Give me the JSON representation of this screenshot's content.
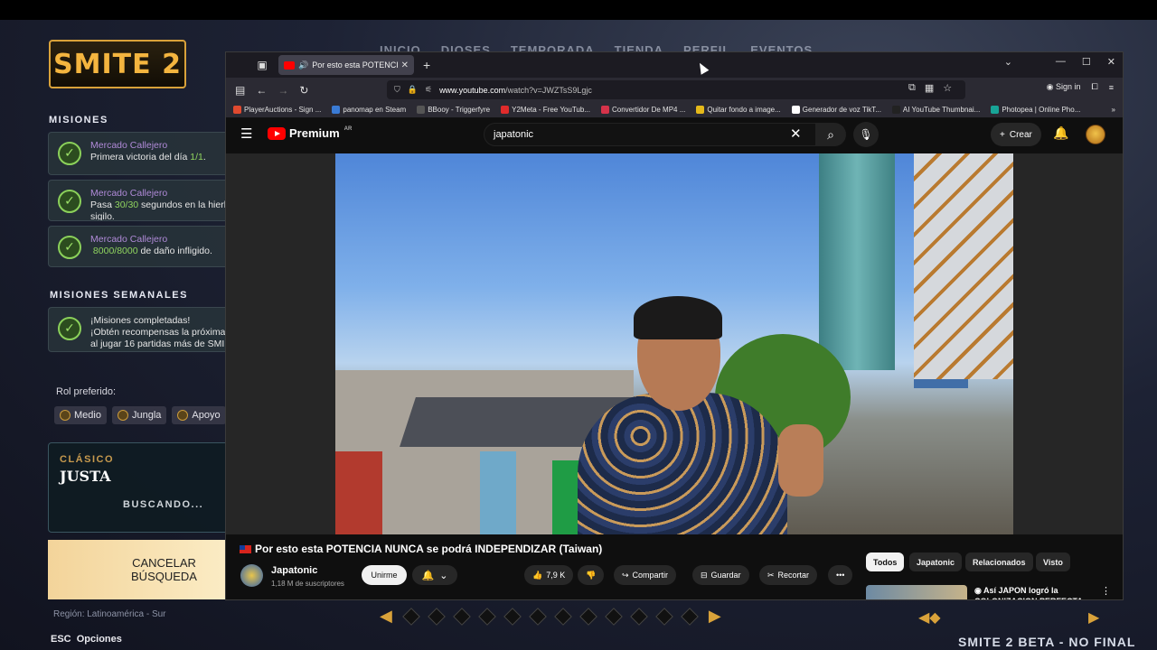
{
  "game": {
    "logo": "SMITE 2",
    "top_nav": [
      "INICIO",
      "DIOSES",
      "TEMPORADA",
      "TIENDA",
      "PERFIL",
      "EVENTOS"
    ],
    "missions_title": "MISIONES",
    "missions": [
      {
        "title": "Mercado Callejero",
        "line1": "Primera victoria del día",
        "progress": "1/1",
        "line2": ""
      },
      {
        "title": "Mercado Callejero",
        "line1_pre": "Pasa ",
        "progress": "30/30",
        "line1_post": " segundos en la hierb",
        "line2": "sigilo."
      },
      {
        "title": "Mercado Callejero",
        "progress": "8000/8000",
        "line1_post": " de daño infligido."
      }
    ],
    "weekly_title": "MISIONES SEMANALES",
    "weekly": {
      "line1": "¡Misiones completadas!",
      "line2": "¡Obtén recompensas la próxima",
      "line3": "al jugar 16 partidas más de SMI"
    },
    "role_label": "Rol preferido:",
    "roles": [
      "Medio",
      "Jungla",
      "Apoyo"
    ],
    "queue": {
      "mode": "CLÁSICO",
      "name": "JUSTA",
      "status": "BUSCANDO..."
    },
    "cancel_label": "CANCELAR BÚSQUEDA",
    "region": "Región: Latinoamérica - Sur",
    "esc_label": "ESC",
    "options_label": "Opciones",
    "bottom_right": "SMITE 2 BETA - NO FINAL"
  },
  "browser": {
    "tab_title": "Por esto esta POTENCIA",
    "url_host": "www.youtube.com",
    "url_path": "/watch?v=JWZTsS9Lgjc",
    "sign_in": "Sign in",
    "bookmarks": [
      {
        "label": "PlayerAuctions - Sign ...",
        "color": "#e04a2f"
      },
      {
        "label": "panomap en Steam",
        "color": "#3a7bd5"
      },
      {
        "label": "BBooy - Triggerfyre",
        "color": "#555555"
      },
      {
        "label": "Y2Meta - Free YouTub...",
        "color": "#e02b2b"
      },
      {
        "label": "Convertidor De MP4 ...",
        "color": "#d6334a"
      },
      {
        "label": "Quitar fondo a image...",
        "color": "#e5b91a"
      },
      {
        "label": "Generador de voz TikT...",
        "color": "#ffffff"
      },
      {
        "label": "AI YouTube Thumbnai...",
        "color": "#222222"
      },
      {
        "label": "Photopea | Online Pho...",
        "color": "#18a497"
      }
    ]
  },
  "youtube": {
    "logo": "Premium",
    "logo_region": "AR",
    "search_query": "japatonic",
    "create_label": "Crear",
    "video_title": "Por esto esta POTENCIA NUNCA se podrá INDEPENDIZAR (Taiwan)",
    "channel": "Japatonic",
    "subscribers": "1,18 M de suscriptores",
    "join_label": "Unirme",
    "likes": "7,9 K",
    "share_label": "Compartir",
    "save_label": "Guardar",
    "clip_label": "Recortar",
    "filters": [
      "Todos",
      "Japatonic",
      "Relacionados",
      "Visto"
    ],
    "rec_title": "Así JAPON logró la COLONIZACION PERFECTA en"
  },
  "colors": {
    "accent": "#f4b53f",
    "yt_red": "#ff0000",
    "mission_title": "#b08ad8",
    "mission_progress": "#8fd35f"
  }
}
